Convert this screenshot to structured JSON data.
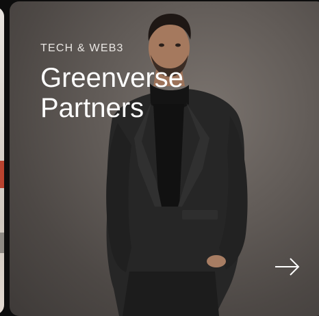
{
  "card": {
    "category": "TECH & WEB3",
    "title": "Greenverse Partners"
  },
  "icons": {
    "next": "arrow-right-icon"
  },
  "colors": {
    "text": "#ffffff",
    "background": "#5c5652",
    "suit": "#262626"
  }
}
